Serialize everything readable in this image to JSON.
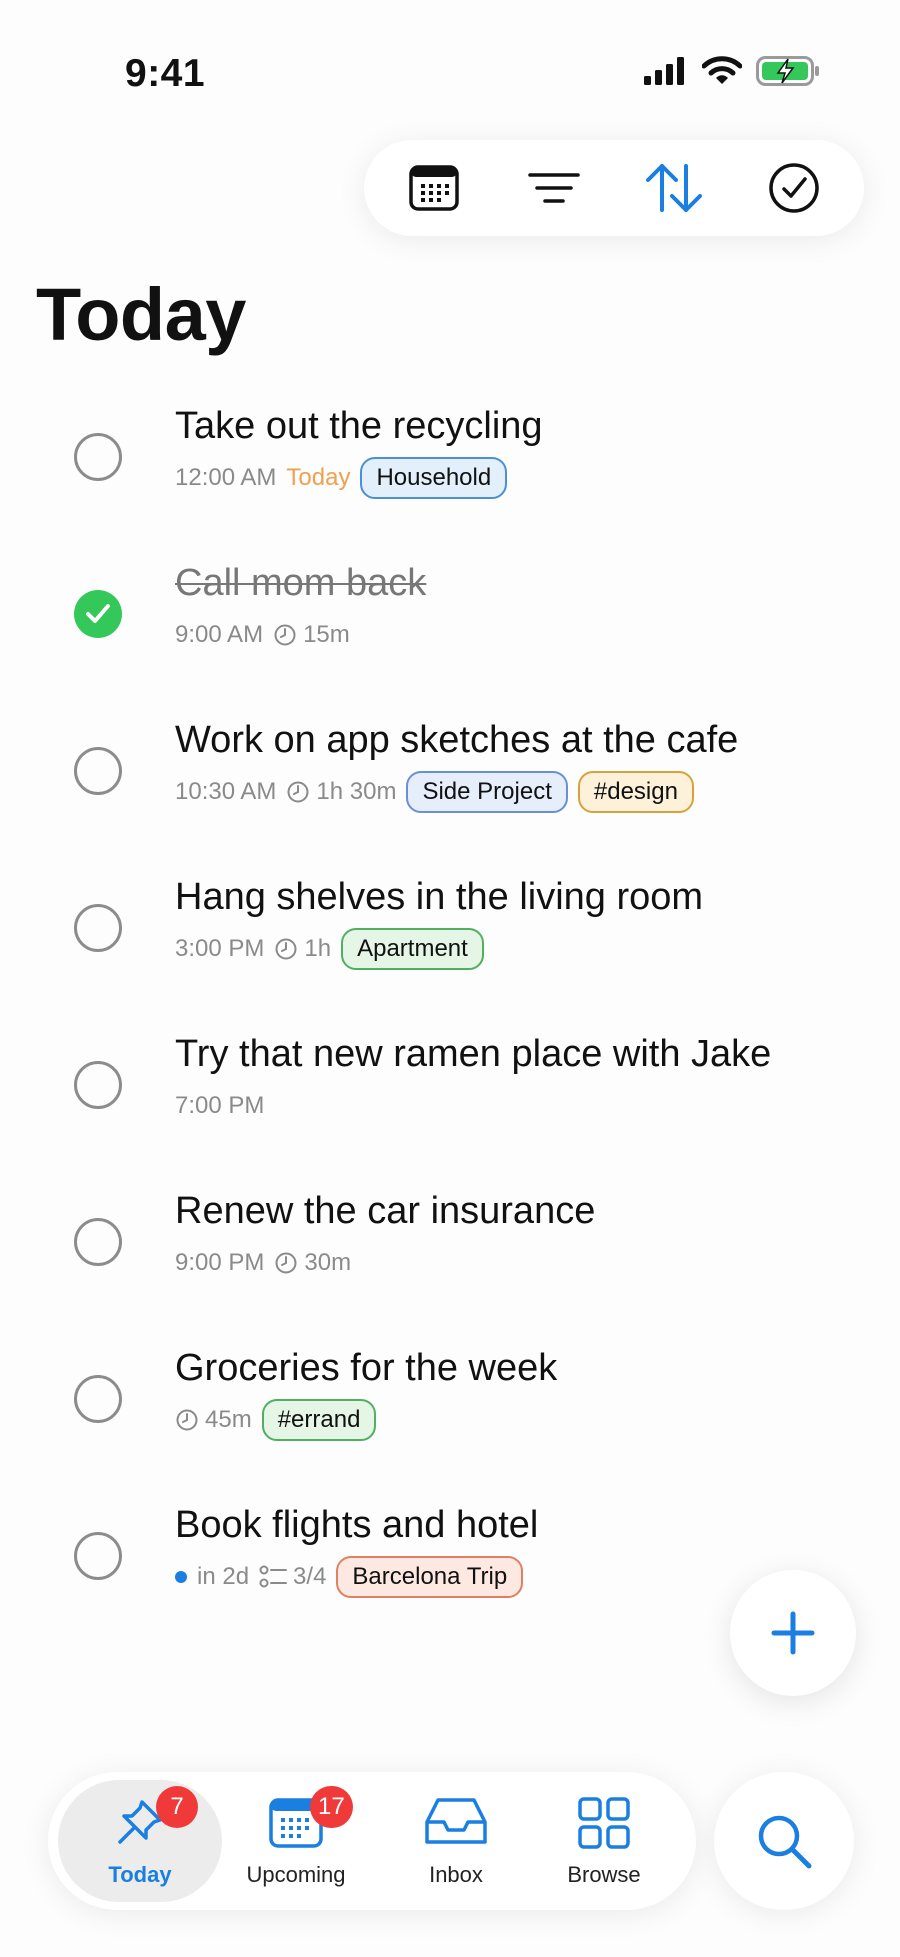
{
  "status_bar": {
    "time": "9:41"
  },
  "toolbar": {
    "buttons": [
      "calendar-icon",
      "filter-icon",
      "sort-icon",
      "checkmark-circle-icon"
    ],
    "accent_color": "#1a7fe0"
  },
  "page": {
    "title": "Today"
  },
  "tasks": [
    {
      "title": "Take out the recycling",
      "time": "12:00 AM",
      "date_label": "Today",
      "tags": [
        "Household"
      ],
      "completed": false
    },
    {
      "title": "Call mom back",
      "time": "9:00 AM",
      "duration": "15m",
      "completed": true
    },
    {
      "title": "Work on app sketches at the cafe",
      "time": "10:30 AM",
      "duration": "1h 30m",
      "tags": [
        "Side Project",
        "#design"
      ],
      "completed": false
    },
    {
      "title": "Hang shelves in the living room",
      "time": "3:00 PM",
      "duration": "1h",
      "tags": [
        "Apartment"
      ],
      "completed": false
    },
    {
      "title": "Try that new ramen place with Jake",
      "time": "7:00 PM",
      "completed": false
    },
    {
      "title": "Renew the car insurance",
      "time": "9:00 PM",
      "duration": "30m",
      "completed": false
    },
    {
      "title": "Groceries for the week",
      "duration": "45m",
      "tags": [
        "#errand"
      ],
      "completed": false
    },
    {
      "title": "Book flights and hotel",
      "due": "in 2d",
      "subtasks": "3/4",
      "tags": [
        "Barcelona Trip"
      ],
      "completed": false
    }
  ],
  "tabbar": {
    "tabs": [
      {
        "label": "Today",
        "badge": "7",
        "active": true
      },
      {
        "label": "Upcoming",
        "badge": "17",
        "active": false
      },
      {
        "label": "Inbox",
        "active": false
      },
      {
        "label": "Browse",
        "active": false
      }
    ]
  },
  "colors": {
    "complete_green": "#34c759",
    "badge_red": "#f03a3a",
    "today_orange": "#f0a050"
  }
}
